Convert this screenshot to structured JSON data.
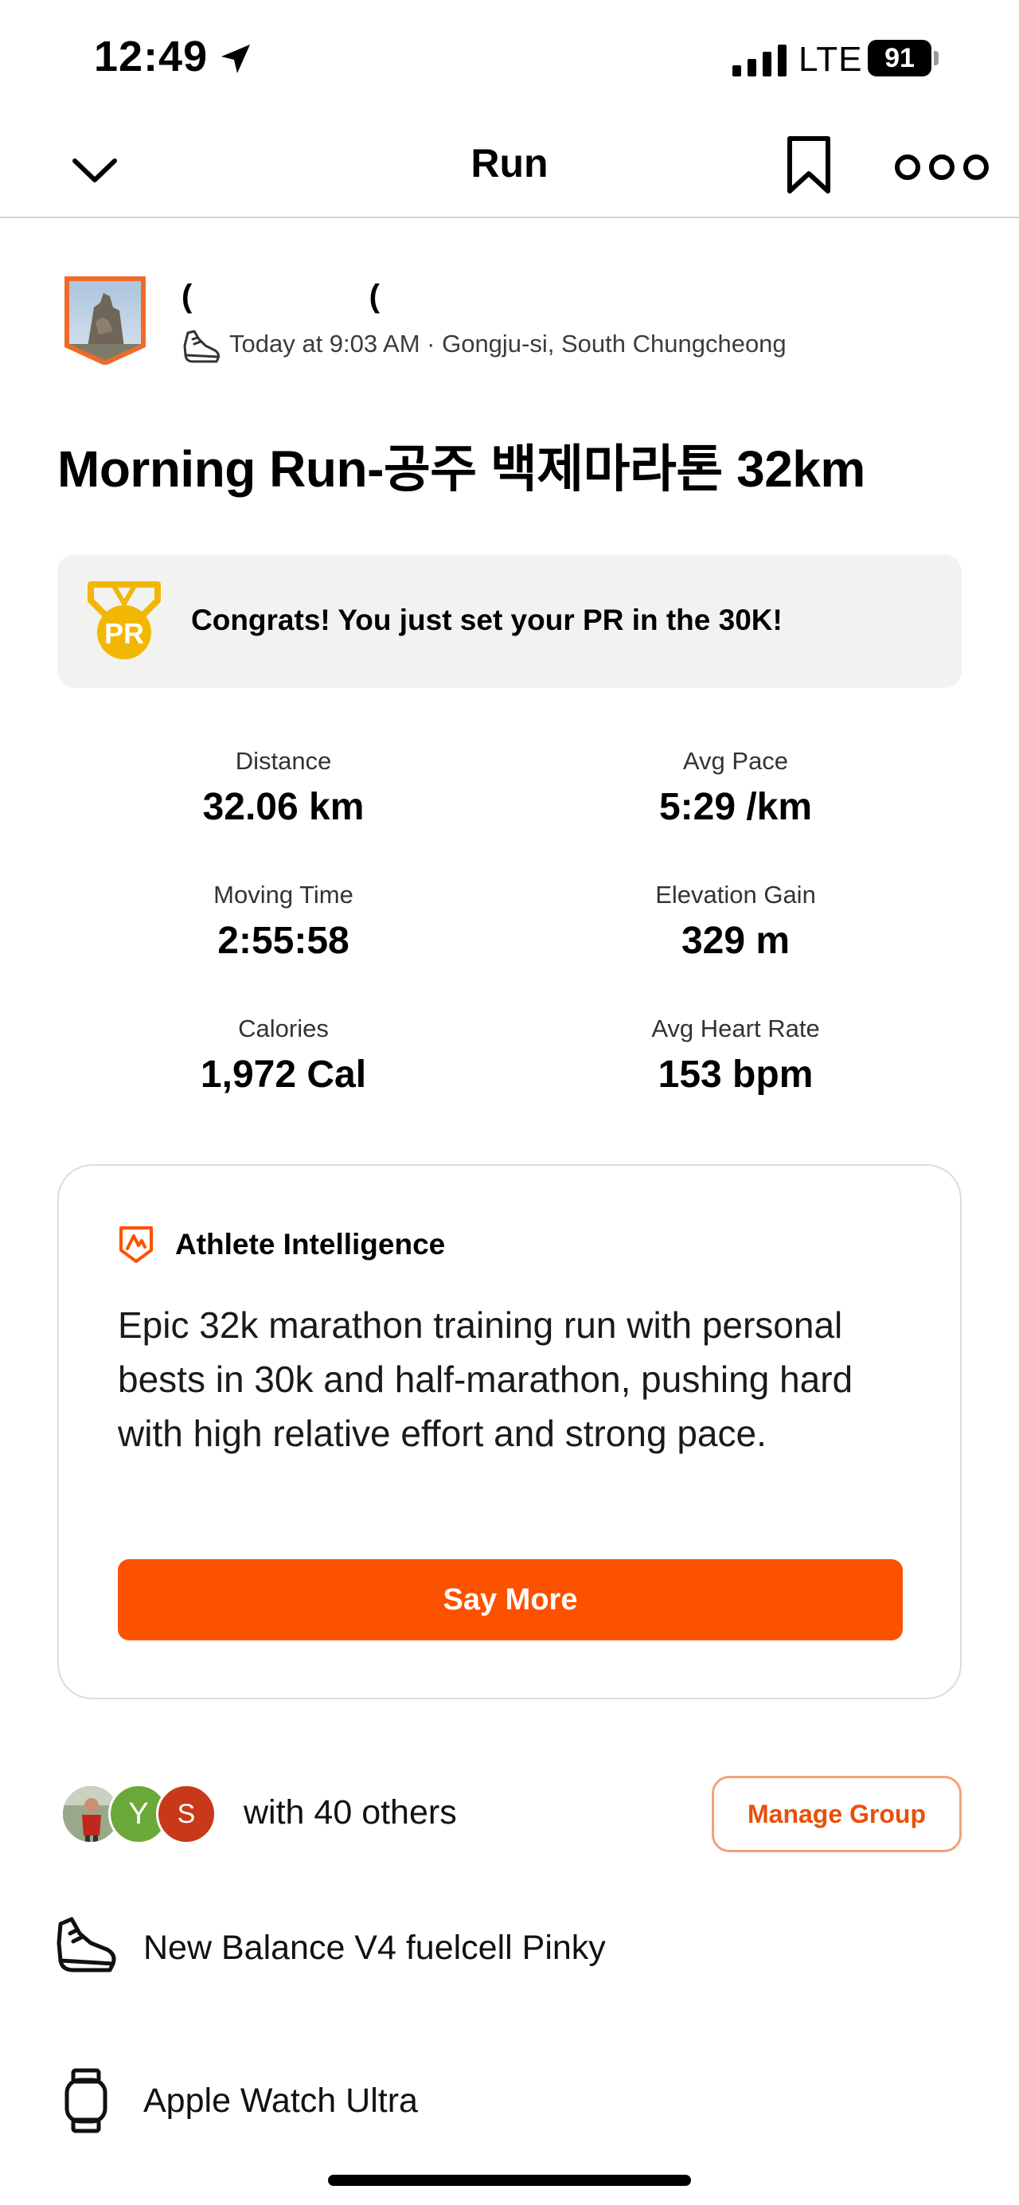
{
  "status_bar": {
    "time": "12:49",
    "network": "LTE",
    "battery": "91"
  },
  "nav": {
    "title": "Run"
  },
  "header": {
    "athlete_name": "(                    (",
    "meta": "Today at 9:03 AM · Gongju-si, South Chungcheong"
  },
  "activity": {
    "title": "Morning Run-공주 백제마라톤 32km"
  },
  "pr_banner": {
    "medal_text": "PR",
    "message": "Congrats! You just set your PR in the 30K!",
    "accent_color": "#f2b705"
  },
  "stats": [
    {
      "label": "Distance",
      "value": "32.06 km"
    },
    {
      "label": "Avg Pace",
      "value": "5:29 /km"
    },
    {
      "label": "Moving Time",
      "value": "2:55:58"
    },
    {
      "label": "Elevation Gain",
      "value": "329 m"
    },
    {
      "label": "Calories",
      "value": "1,972 Cal"
    },
    {
      "label": "Avg Heart Rate",
      "value": "153 bpm"
    }
  ],
  "athlete_intelligence": {
    "heading": "Athlete Intelligence",
    "summary": "Epic 32k marathon training run with personal bests in 30k and half-marathon, pushing hard with high relative effort and strong pace.",
    "button_label": "Say More",
    "accent_color": "#fc5200"
  },
  "group": {
    "avatars": [
      {
        "type": "photo",
        "initial": ""
      },
      {
        "type": "initial",
        "initial": "Y",
        "color": "#6ba83a"
      },
      {
        "type": "initial",
        "initial": "S",
        "color": "#c8391a"
      }
    ],
    "label": "with 40 others",
    "manage_button": "Manage Group"
  },
  "gear": {
    "shoe": {
      "icon": "running-shoe-icon",
      "label": "New Balance V4 fuelcell Pinky"
    },
    "device": {
      "icon": "watch-icon",
      "label": "Apple Watch Ultra"
    }
  }
}
